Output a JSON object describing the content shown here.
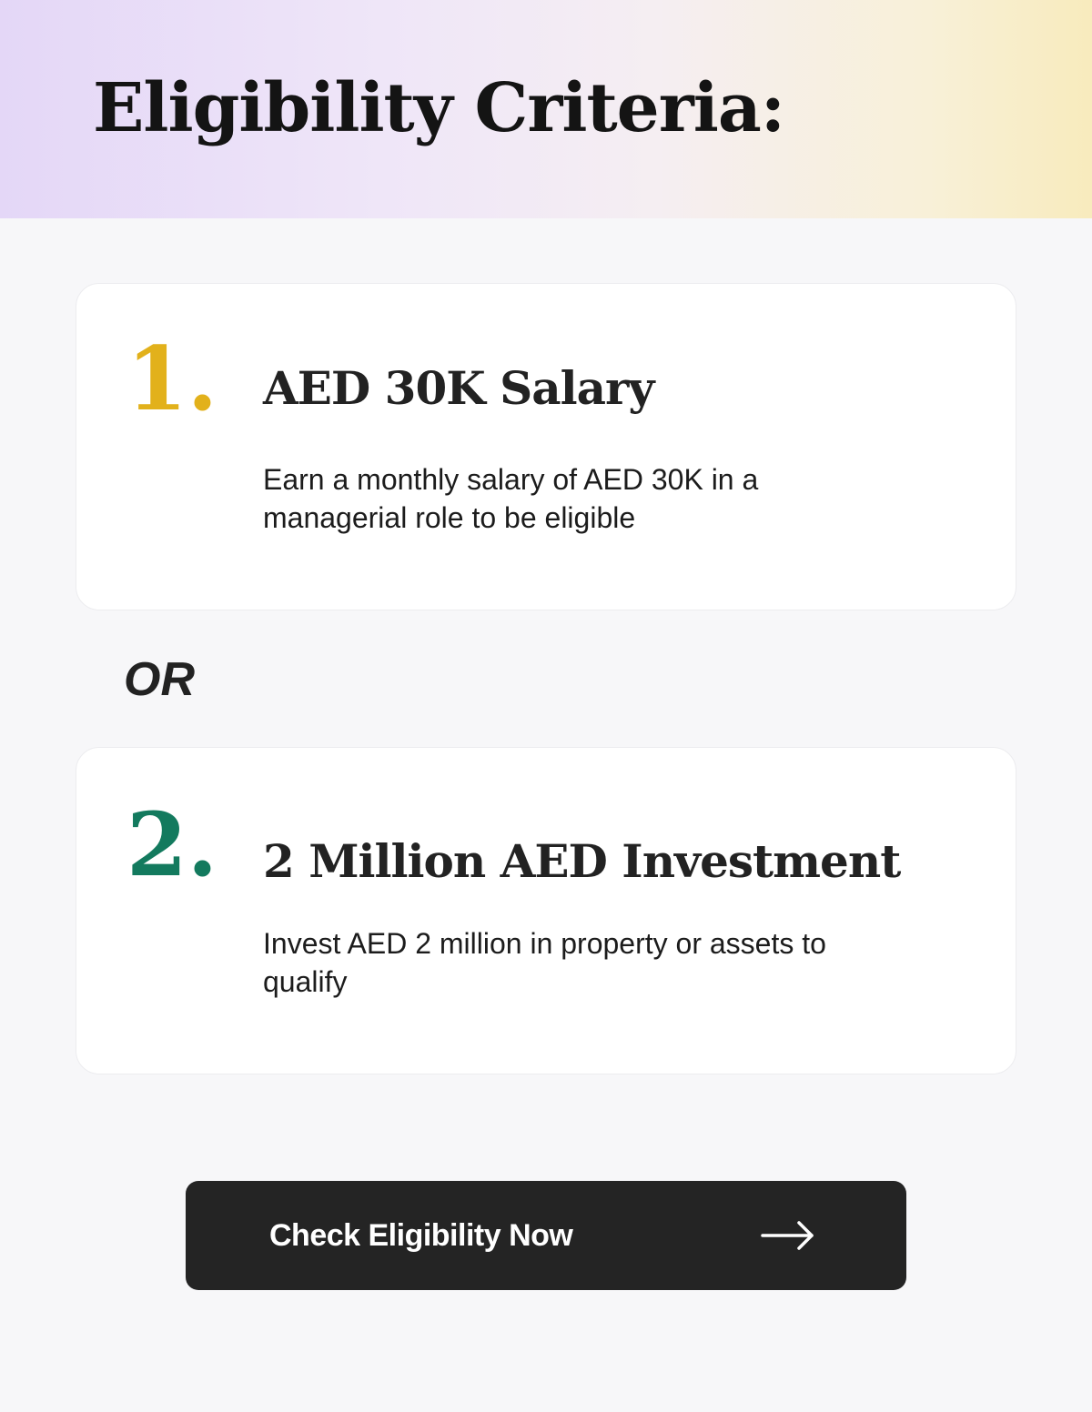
{
  "header": {
    "title": "Eligibility Criteria:"
  },
  "criteria": [
    {
      "number": "1.",
      "title": "AED 30K Salary",
      "description": "Earn a monthly salary of AED 30K in a managerial role to be eligible",
      "number_color": "#e2b11b"
    },
    {
      "number": "2.",
      "title": "2 Million AED Investment",
      "description": "Invest AED 2 million in property or assets to qualify",
      "number_color": "#137a5e"
    }
  ],
  "separator": "OR",
  "cta": {
    "label": "Check Eligibility Now",
    "icon": "arrow-right-icon",
    "background": "#242424"
  },
  "colors": {
    "page_background": "#f7f7f9",
    "header_gradient_start": "#e4d7f7",
    "header_gradient_end": "#f8ebbd"
  }
}
